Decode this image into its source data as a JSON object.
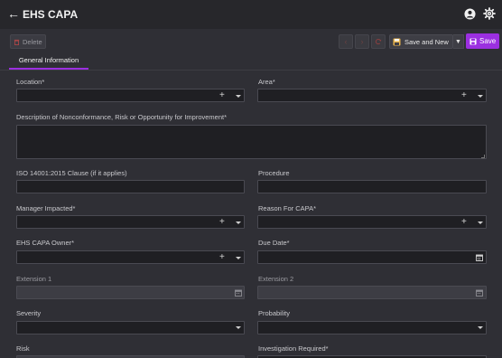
{
  "app": {
    "title": "EHS CAPA"
  },
  "toolbar": {
    "delete_label": "Delete",
    "save_new_label": "Save and New",
    "save_label": "Save"
  },
  "tabs": [
    {
      "label": "General Information",
      "active": true
    }
  ],
  "colors": {
    "accent": "#9b2fe0",
    "background": "#2f2f35",
    "titlebar": "#27272b"
  },
  "fields": {
    "location": {
      "label": "Location*",
      "value": ""
    },
    "area": {
      "label": "Area*",
      "value": ""
    },
    "description": {
      "label": "Description of Nonconformance, Risk or Opportunity for Improvement*",
      "value": ""
    },
    "iso_clause": {
      "label": "ISO 14001:2015 Clause (if it applies)",
      "value": ""
    },
    "procedure": {
      "label": "Procedure",
      "value": ""
    },
    "manager_impacted": {
      "label": "Manager Impacted*",
      "value": ""
    },
    "reason_for_capa": {
      "label": "Reason For CAPA*",
      "value": ""
    },
    "ehs_capa_owner": {
      "label": "EHS CAPA Owner*",
      "value": ""
    },
    "due_date": {
      "label": "Due Date*",
      "value": ""
    },
    "extension_1": {
      "label": "Extension 1",
      "value": ""
    },
    "extension_2": {
      "label": "Extension 2",
      "value": ""
    },
    "severity": {
      "label": "Severity",
      "value": ""
    },
    "probability": {
      "label": "Probability",
      "value": ""
    },
    "risk": {
      "label": "Risk",
      "value": ""
    },
    "investigation_required": {
      "label": "Investigation Required*",
      "value": ""
    }
  },
  "icons": [
    "back-arrow-icon",
    "user-icon",
    "gear-icon",
    "trash-icon",
    "chevron-left-icon",
    "chevron-right-icon",
    "refresh-icon",
    "save-icon",
    "plus-icon",
    "chevron-down-icon",
    "calendar-icon"
  ]
}
